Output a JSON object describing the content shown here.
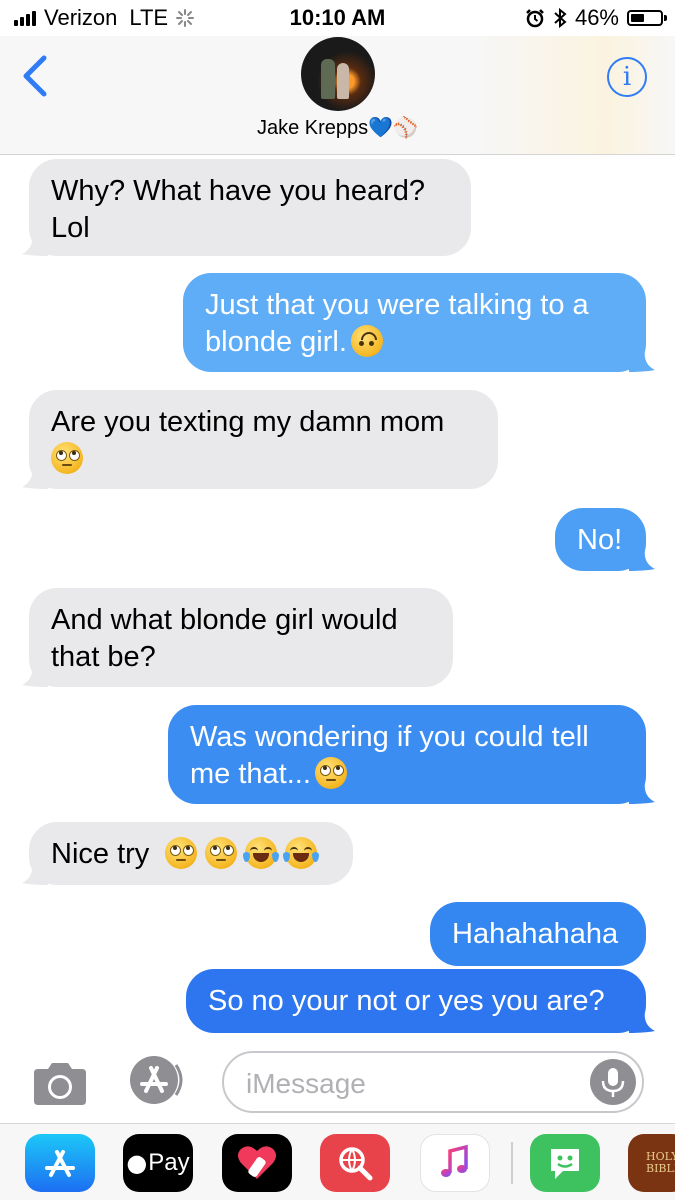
{
  "status_bar": {
    "carrier": "Verizon",
    "network": "LTE",
    "time": "10:10 AM",
    "battery_pct": "46%",
    "battery_level": 0.46,
    "icons": [
      "signal-icon",
      "activity-spinner-icon",
      "alarm-icon",
      "bluetooth-icon",
      "battery-icon"
    ]
  },
  "header": {
    "contact_name": "Jake Krepps💙⚾",
    "icons": [
      "back-chevron-icon",
      "info-icon"
    ],
    "accent_color": "#2f7cf6"
  },
  "messages": [
    {
      "dir": "in",
      "lines": [
        "Why? What have you heard?",
        "Lol"
      ],
      "emoji": []
    },
    {
      "dir": "out",
      "lines": [
        "Just that you were talking to a",
        "blonde girl."
      ],
      "emoji": [
        "upside-down-face-icon"
      ]
    },
    {
      "dir": "in",
      "lines": [
        "Are you texting my damn mom",
        ""
      ],
      "emoji": [
        "eye-roll-face-icon"
      ]
    },
    {
      "dir": "out",
      "lines": [
        "No!"
      ],
      "emoji": []
    },
    {
      "dir": "in",
      "lines": [
        "And what blonde girl would",
        "that be?"
      ],
      "emoji": []
    },
    {
      "dir": "out",
      "lines": [
        "Was wondering if you could tell",
        "me that..."
      ],
      "emoji": [
        "eye-roll-face-icon"
      ]
    },
    {
      "dir": "in",
      "lines": [
        "Nice try"
      ],
      "emoji": [
        "eye-roll-face-icon",
        "eye-roll-face-icon",
        "tears-of-joy-face-icon",
        "tears-of-joy-face-icon"
      ]
    },
    {
      "dir": "out",
      "lines": [
        "Hahahahaha"
      ],
      "emoji": []
    },
    {
      "dir": "out",
      "lines": [
        "So no your not or yes you are?"
      ],
      "emoji": []
    }
  ],
  "colors": {
    "incoming_bubble": "#e9e9eb",
    "outgoing_bubble_top": "#62aef7",
    "outgoing_bubble_bottom": "#2d76ef"
  },
  "input": {
    "placeholder": "iMessage",
    "icons": [
      "camera-icon",
      "app-store-icon",
      "microphone-icon"
    ]
  },
  "app_drawer": {
    "pay_label": "Pay",
    "bible_label": "HOLY BIBLE",
    "icons": [
      "app-store-icon",
      "apple-pay-icon",
      "digital-touch-icon",
      "web-search-icon",
      "music-icon",
      "bitmoji-icon",
      "bible-icon"
    ]
  }
}
